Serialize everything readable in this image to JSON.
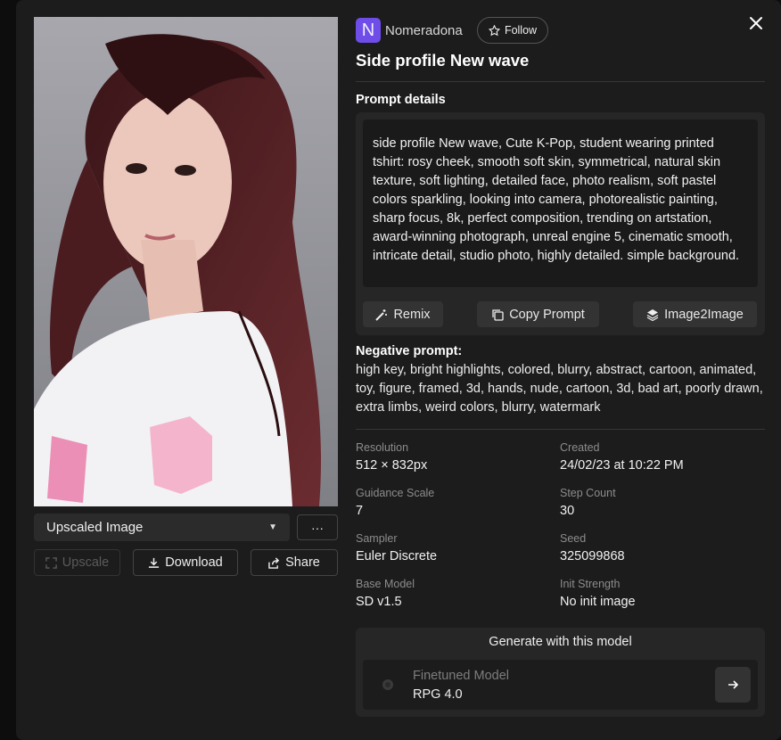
{
  "image": {
    "view_select": "Upscaled Image",
    "more_label": "···",
    "actions": {
      "upscale": "Upscale",
      "download": "Download",
      "share": "Share"
    }
  },
  "author": {
    "avatar_letter": "N",
    "name": "Nomeradona",
    "follow_label": "Follow"
  },
  "title": "Side profile New wave",
  "prompt": {
    "heading": "Prompt details",
    "text": "side profile New wave, Cute K-Pop, student wearing printed tshirt: rosy cheek, smooth soft skin, symmetrical, natural skin texture, soft lighting, detailed face, photo realism, soft pastel colors sparkling, looking into camera, photorealistic painting, sharp focus, 8k, perfect composition, trending on artstation, award-winning photograph, unreal engine 5, cinematic smooth, intricate detail, studio photo, highly detailed. simple background.",
    "buttons": {
      "remix": "Remix",
      "copy": "Copy Prompt",
      "img2img": "Image2Image"
    }
  },
  "negative": {
    "heading": "Negative prompt:",
    "text": "high key, bright highlights, colored, blurry, abstract, cartoon, animated, toy, figure, framed, 3d, hands, nude, cartoon, 3d, bad art, poorly drawn, extra limbs, weird colors, blurry, watermark"
  },
  "meta": {
    "resolution": {
      "label": "Resolution",
      "value": "512 × 832px"
    },
    "created": {
      "label": "Created",
      "value": "24/02/23 at 10:22 PM"
    },
    "guidance": {
      "label": "Guidance Scale",
      "value": "7"
    },
    "steps": {
      "label": "Step Count",
      "value": "30"
    },
    "sampler": {
      "label": "Sampler",
      "value": "Euler Discrete"
    },
    "seed": {
      "label": "Seed",
      "value": "325099868"
    },
    "base_model": {
      "label": "Base Model",
      "value": "SD v1.5"
    },
    "init_strength": {
      "label": "Init Strength",
      "value": "No init image"
    }
  },
  "generate": {
    "heading": "Generate with this model",
    "model_type": "Finetuned Model",
    "model_name": "RPG 4.0"
  },
  "colors": {
    "accent": "#6e4de8",
    "background": "#1c1c1c",
    "panel": "#262626"
  }
}
